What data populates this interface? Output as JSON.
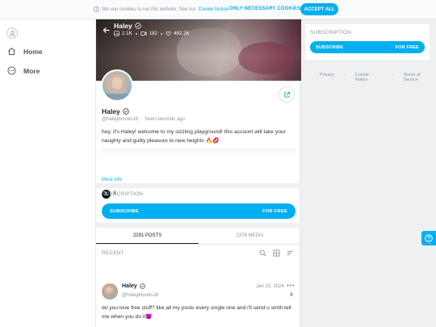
{
  "cookie": {
    "message": "We use cookies to run this website. See our",
    "link": "Cookie Notice.",
    "necessary_label": "ONLY NECESSARY COOKIES",
    "accept_label": "ACCEPT ALL"
  },
  "nav": {
    "items": [
      {
        "label": "Home",
        "icon": "home-icon"
      },
      {
        "label": "More",
        "icon": "more-circle-icon"
      }
    ]
  },
  "profile": {
    "name": "Haley",
    "handle": "@haleybrooks18",
    "status": "Seen  seconds ago",
    "stats": {
      "photos": "2.1K",
      "videos": "182",
      "likes": "492.2K"
    },
    "bio": "hey, it's Haley! welcome to my sizzling playground! this account will take your naughty and guilty pleasure to new heights 🔥💋",
    "more_info": "More info",
    "social": {
      "icon_letter": "𝕏",
      "label": "X"
    }
  },
  "subscription": {
    "label": "SUBSCRIPTION",
    "button_left": "SUBSCRIBE",
    "button_right": "FOR FREE"
  },
  "tabs": [
    {
      "label": "2291 POSTS",
      "active": true
    },
    {
      "label": "2378 MEDIA",
      "active": false
    }
  ],
  "feed": {
    "label": "RECENT",
    "post": {
      "name": "Haley",
      "handle": "@haleybrooks18",
      "date": "Jan 23, 2024",
      "more": "•••",
      "text": "do you love free stuff? like all my posts every single one and i'll send u smth tell me when you do it😈"
    }
  },
  "sidebar": {
    "subscription_label": "SUBSCRIPTION",
    "button_left": "SUBSCRIBE",
    "button_right": "FOR FREE",
    "footer_links": [
      "Privacy",
      "Cookie Notice",
      "Terms of Service"
    ]
  },
  "colors": {
    "accent": "#00aff0",
    "muted": "#8a96a3"
  }
}
